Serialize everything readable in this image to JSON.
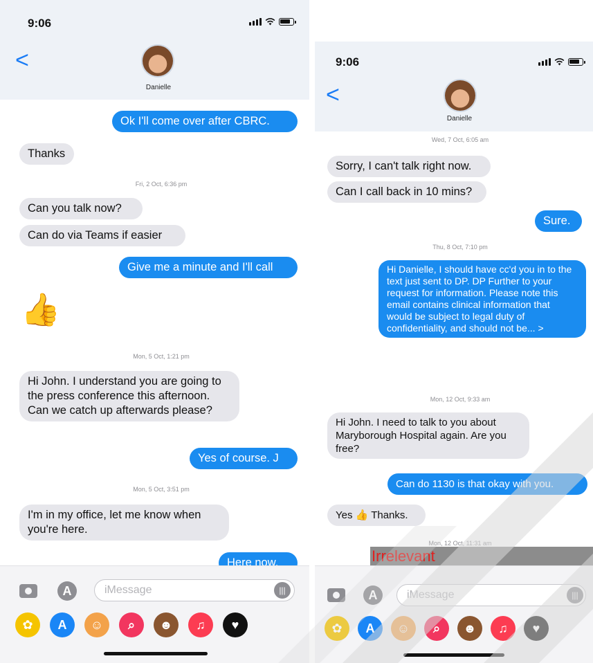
{
  "left": {
    "status": {
      "time": "9:06"
    },
    "header": {
      "contact_name": "Danielle",
      "back_label": "<"
    },
    "messages": [
      {
        "text": "Ok I'll come over after CBRC."
      },
      {
        "text": "Thanks"
      },
      {
        "text": "Fri, 2 Oct, 6:36 pm"
      },
      {
        "text": "Can you talk now?"
      },
      {
        "text": "Can do via Teams if easier"
      },
      {
        "text": "Give me a minute and I'll call"
      },
      {
        "text": "👍"
      },
      {
        "text": "Mon, 5 Oct, 1:21 pm"
      },
      {
        "text": "Hi John. I understand you are going to the press conference this afternoon. Can we catch up afterwards please?"
      },
      {
        "text": "Yes of course. J"
      },
      {
        "text": "Mon, 5 Oct, 3:51 pm"
      },
      {
        "text": "I'm in my office, let me know when you're here."
      },
      {
        "text": "Here now."
      }
    ],
    "composer": {
      "placeholder": "iMessage"
    }
  },
  "right": {
    "status": {
      "time": "9:06"
    },
    "header": {
      "contact_name": "Danielle",
      "back_label": "<"
    },
    "messages": [
      {
        "text": "Wed, 7 Oct, 6:05 am"
      },
      {
        "text": "Sorry, I can't talk right now."
      },
      {
        "text": "Can I call back in 10 mins?"
      },
      {
        "text": "Sure."
      },
      {
        "text": "Thu, 8 Oct, 7:10 pm"
      },
      {
        "text": "Hi Danielle, I should have cc'd you in to the text just sent to DP. DP Further to your request for information. Please note this email contains clinical information that would be subject to legal duty of confidentiality, and should not be... >"
      },
      {
        "text": "Mon, 12 Oct, 9:33 am"
      },
      {
        "text": "Hi John. I need to talk to you about Maryborough Hospital again. Are you free?"
      },
      {
        "text": "Can do 1130 is that okay with you."
      },
      {
        "text": "Yes 👍 Thanks."
      },
      {
        "text": "Mon, 12 Oct, 11:31 am"
      }
    ],
    "redaction_label": "Irrelevant",
    "composer": {
      "placeholder": "iMessage"
    }
  },
  "icons": {
    "camera": "camera-icon",
    "app_store": "app-store-icon",
    "audio": "audio-icon",
    "tray": [
      "photos-icon",
      "app-store-icon",
      "memoji-icon",
      "search-icon",
      "animoji-icon",
      "music-icon",
      "heart-icon"
    ]
  },
  "colors": {
    "outgoing_bubble": "#1a8cf0",
    "incoming_bubble": "#e6e6eb",
    "ios_blue": "#1a7cf6",
    "redaction_grey": "#8c8c8c",
    "redaction_text": "#e0201f"
  }
}
